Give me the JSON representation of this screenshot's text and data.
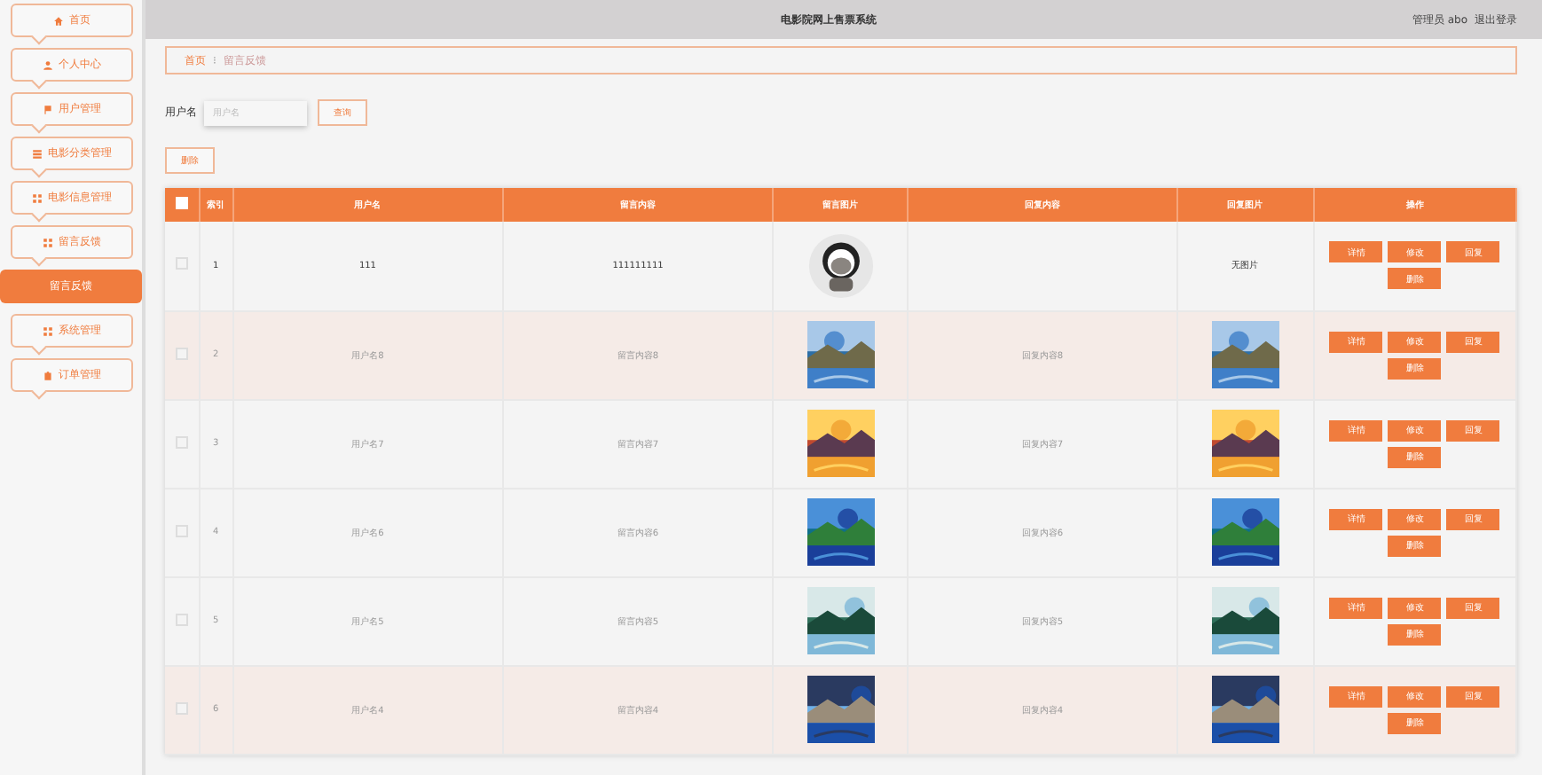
{
  "sidebar": {
    "items": [
      {
        "label": "首页",
        "selected": false
      },
      {
        "label": "个人中心",
        "selected": false
      },
      {
        "label": "用户管理",
        "selected": false
      },
      {
        "label": "电影分类管理",
        "selected": false
      },
      {
        "label": "电影信息管理",
        "selected": false
      },
      {
        "label": "留言反馈",
        "selected": false
      },
      {
        "label": "留言反馈",
        "selected": true
      },
      {
        "label": "系统管理",
        "selected": false
      },
      {
        "label": "订单管理",
        "selected": false
      }
    ]
  },
  "header": {
    "title": "电影院网上售票系统",
    "user": "管理员 abo",
    "logout": "退出登录"
  },
  "breadcrumb": {
    "home": "首页",
    "separator": "⁝",
    "current": "留言反馈"
  },
  "search": {
    "label": "用户名",
    "placeholder": "用户名",
    "button": "查询"
  },
  "delete_button": "删除",
  "table": {
    "select_all": {
      "checked": false
    },
    "columns": [
      "索引",
      "用户名",
      "留言内容",
      "留言图片",
      "回复内容",
      "回复图片",
      "操作"
    ],
    "rows": [
      {
        "checked": false,
        "index": "1",
        "user": "111",
        "message": "111111111",
        "message_image": {
          "kind": "avatar"
        },
        "reply": "",
        "reply_image": {
          "kind": "text",
          "text": "无图片"
        },
        "highlighted": false,
        "strong": true,
        "actions": [
          "详情",
          "修改",
          "回复",
          "删除"
        ]
      },
      {
        "checked": false,
        "index": "2",
        "user": "用户名8",
        "message": "留言内容8",
        "message_image": {
          "kind": "picture"
        },
        "reply": "回复内容8",
        "reply_image": {
          "kind": "picture"
        },
        "highlighted": true,
        "strong": false,
        "actions": [
          "详情",
          "修改",
          "回复",
          "删除"
        ]
      },
      {
        "checked": false,
        "index": "3",
        "user": "用户名7",
        "message": "留言内容7",
        "message_image": {
          "kind": "picture"
        },
        "reply": "回复内容7",
        "reply_image": {
          "kind": "picture"
        },
        "highlighted": false,
        "strong": false,
        "actions": [
          "详情",
          "修改",
          "回复",
          "删除"
        ]
      },
      {
        "checked": false,
        "index": "4",
        "user": "用户名6",
        "message": "留言内容6",
        "message_image": {
          "kind": "picture"
        },
        "reply": "回复内容6",
        "reply_image": {
          "kind": "picture"
        },
        "highlighted": false,
        "strong": false,
        "actions": [
          "详情",
          "修改",
          "回复",
          "删除"
        ]
      },
      {
        "checked": false,
        "index": "5",
        "user": "用户名5",
        "message": "留言内容5",
        "message_image": {
          "kind": "picture"
        },
        "reply": "回复内容5",
        "reply_image": {
          "kind": "picture"
        },
        "highlighted": false,
        "strong": false,
        "actions": [
          "详情",
          "修改",
          "回复",
          "删除"
        ]
      },
      {
        "checked": false,
        "index": "6",
        "user": "用户名4",
        "message": "留言内容4",
        "message_image": {
          "kind": "picture"
        },
        "reply": "回复内容4",
        "reply_image": {
          "kind": "picture"
        },
        "highlighted": true,
        "strong": false,
        "actions": [
          "详情",
          "修改",
          "回复",
          "删除"
        ]
      }
    ]
  }
}
